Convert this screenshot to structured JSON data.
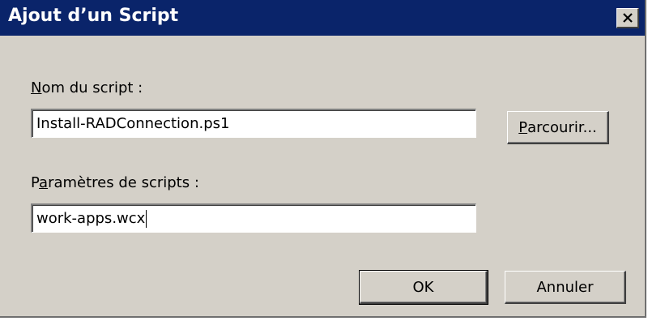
{
  "window": {
    "title": "Ajout d’un Script",
    "close_glyph": "✕"
  },
  "script_name": {
    "label_accesskey": "N",
    "label_rest": "om du script :",
    "value": "Install-RADConnection.ps1"
  },
  "browse_button": {
    "accesskey": "P",
    "label_rest": "arcourir..."
  },
  "script_params": {
    "label_prefix": "P",
    "label_accesskey": "a",
    "label_rest": "ramètres de scripts :",
    "value": "work-apps.wcx"
  },
  "buttons": {
    "ok": "OK",
    "cancel": "Annuler"
  },
  "colors": {
    "titlebar": "#0a246a",
    "dialog_face": "#d4d0c8",
    "title_text": "#ffffff"
  },
  "icons": {
    "close": "close-icon"
  }
}
